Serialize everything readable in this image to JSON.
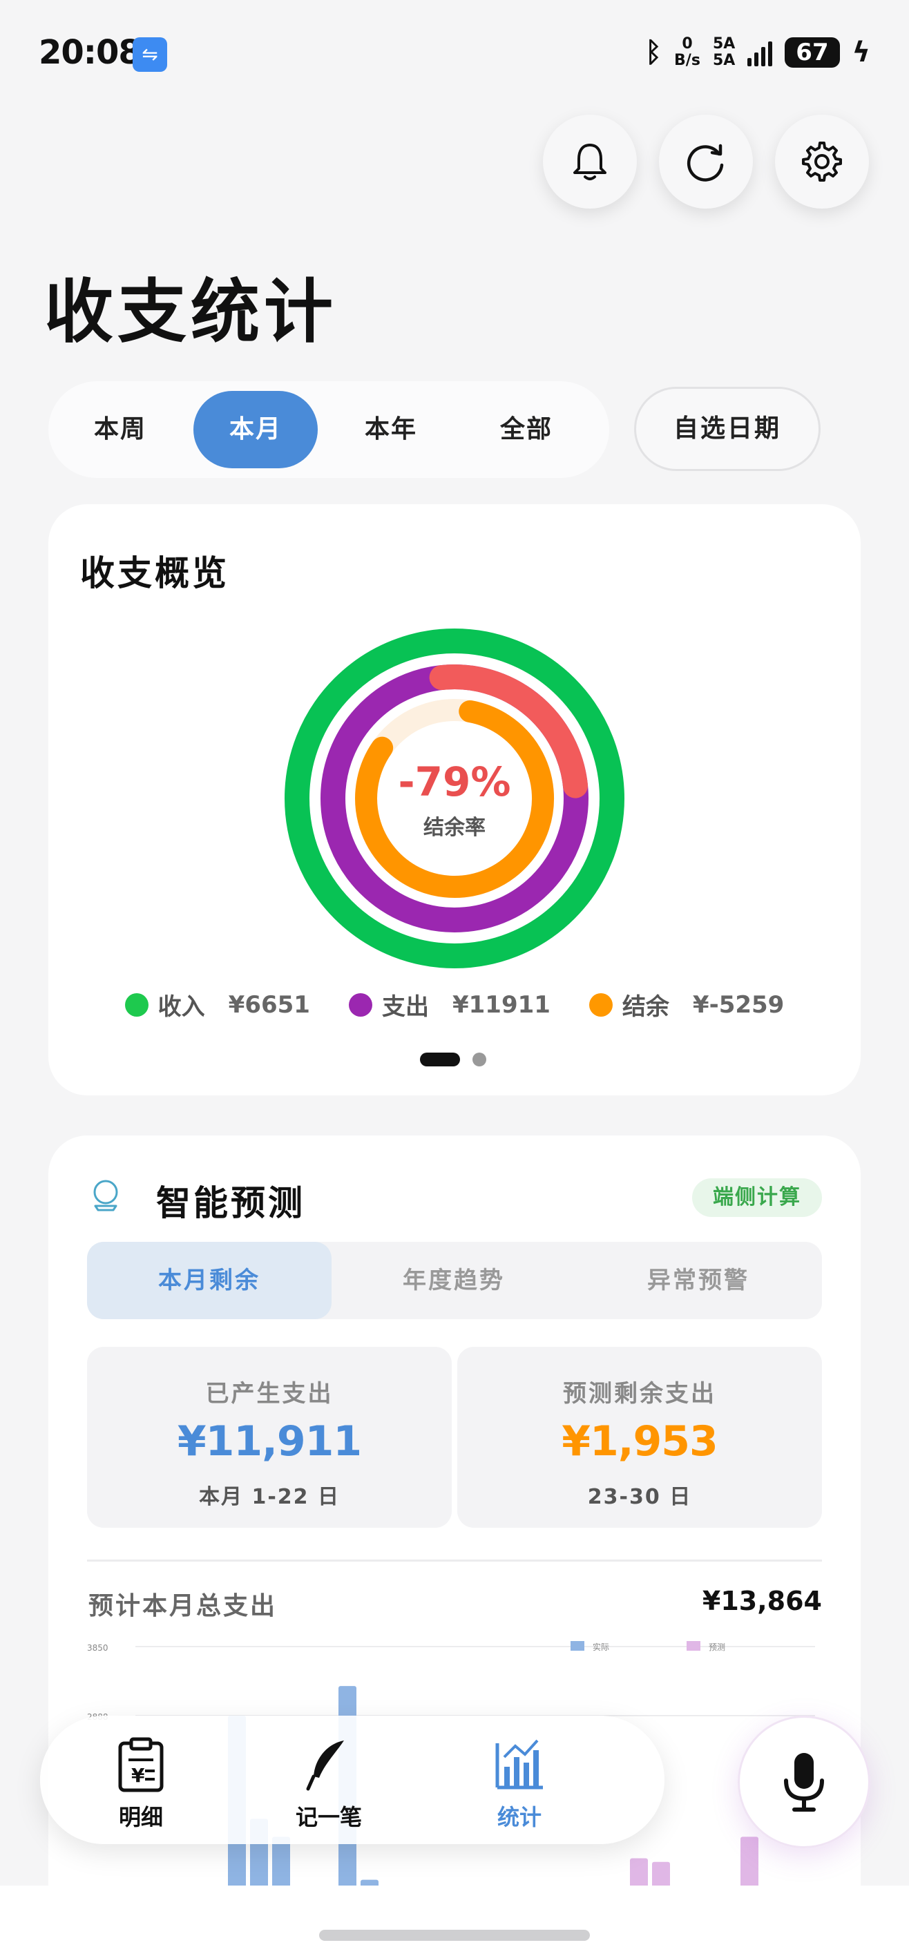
{
  "status_bar": {
    "time": "20:08",
    "usb_icon": "usb-icon",
    "bluetooth_icon": "bluetooth-icon",
    "net_speed_value": "0",
    "net_speed_unit": "B/s",
    "signal_label_1": "5A",
    "signal_label_2": "5A",
    "battery": "67"
  },
  "header": {
    "title": "收支统计",
    "icons": [
      "bell-icon",
      "refresh-icon",
      "gear-icon"
    ]
  },
  "period_tabs": {
    "items": [
      {
        "label": "本周"
      },
      {
        "label": "本月",
        "active": true
      },
      {
        "label": "本年"
      },
      {
        "label": "全部"
      }
    ],
    "custom_label": "自选日期"
  },
  "overview": {
    "title": "收支概览",
    "rate_value": "-79%",
    "rate_label": "结余率",
    "legend": [
      {
        "label": "收入",
        "value": "¥6651",
        "color": "#1ec94e"
      },
      {
        "label": "支出",
        "value": "¥11911",
        "color": "#9b27b0"
      },
      {
        "label": "结余",
        "value": "¥-5259",
        "color": "#ff9800"
      }
    ],
    "colors": {
      "income": "#08c254",
      "expense": "#9b27b0",
      "expense_overflow": "#f25b5b",
      "balance": "#ff9500",
      "balance_track": "#fdf0e0",
      "rate": "#e94f4f"
    }
  },
  "predict": {
    "title": "智能预测",
    "badge": "端侧计算",
    "tabs": [
      {
        "label": "本月剩余",
        "active": true
      },
      {
        "label": "年度趋势"
      },
      {
        "label": "异常预警"
      }
    ],
    "spent": {
      "label": "已产生支出",
      "value": "¥11,911",
      "range": "本月 1-22 日",
      "color": "#4a8bd8"
    },
    "forecast": {
      "label": "预测剩余支出",
      "value": "¥1,953",
      "range": "23-30 日",
      "color": "#ff9500"
    },
    "total_label": "预计本月总支出",
    "total_value": "¥13,864"
  },
  "chart_data": {
    "type": "bar",
    "y_ticks": [
      "3850",
      "2888"
    ],
    "series": [
      {
        "name": "实际",
        "color": "#8fb4e3"
      },
      {
        "name": "预测",
        "color": "#e0b7e6"
      }
    ],
    "actual_values": [
      0,
      220,
      410,
      0,
      2888,
      1450,
      1200,
      0,
      0,
      3300,
      600,
      400
    ],
    "forecast_values": [
      0,
      0,
      0,
      900,
      850,
      400,
      0,
      200,
      1200,
      300
    ],
    "ylim": [
      0,
      3850
    ]
  },
  "nav": {
    "items": [
      {
        "label": "明细",
        "icon": "clipboard-icon"
      },
      {
        "label": "记一笔",
        "icon": "feather-icon"
      },
      {
        "label": "统计",
        "icon": "bar-chart-icon",
        "active": true
      }
    ],
    "mic_icon": "microphone-icon"
  }
}
